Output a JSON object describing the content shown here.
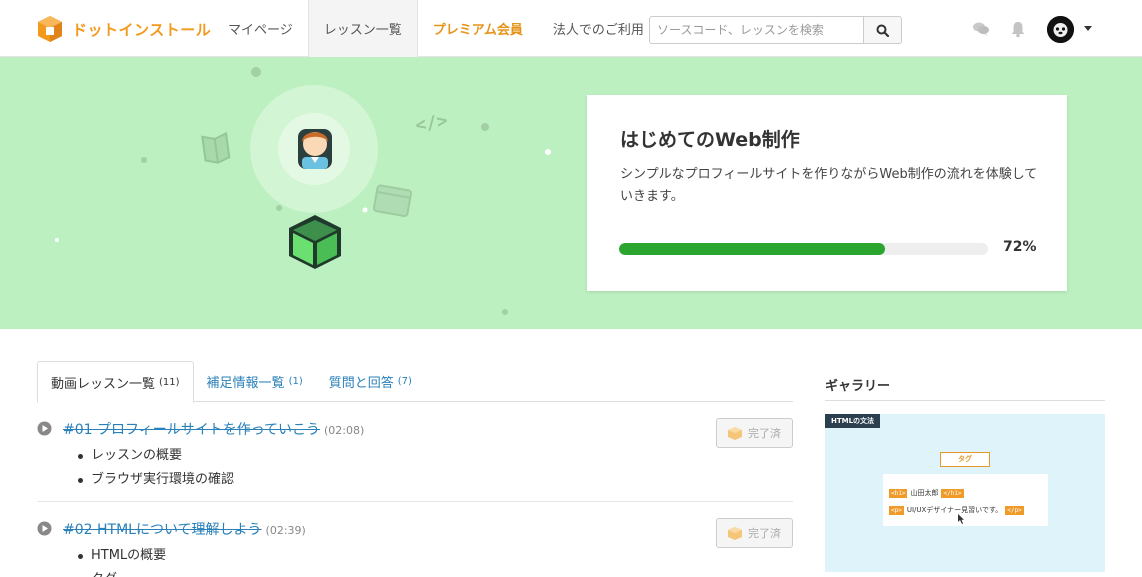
{
  "header": {
    "logo_text": "ドットインストール",
    "nav": [
      {
        "label": "マイページ"
      },
      {
        "label": "レッスン一覧"
      },
      {
        "label": "プレミアム会員"
      },
      {
        "label": "法人でのご利用"
      }
    ],
    "search_placeholder": "ソースコード、レッスンを検索"
  },
  "hero": {
    "title": "はじめてのWeb制作",
    "description": "シンプルなプロフィールサイトを作りながらWeb制作の流れを体験していきます。",
    "progress_percent": 72,
    "progress_label": "72%"
  },
  "tabs": [
    {
      "label": "動画レッスン一覧",
      "count": "(11)"
    },
    {
      "label": "補足情報一覧",
      "count": "(1)"
    },
    {
      "label": "質問と回答",
      "count": "(7)"
    }
  ],
  "lessons": [
    {
      "title": "#01 プロフィールサイトを作っていこう",
      "duration": "(02:08)",
      "topics": [
        "レッスンの概要",
        "ブラウザ実行環境の確認"
      ],
      "status": "完了済"
    },
    {
      "title": "#02 HTMLについて理解しよう",
      "duration": "(02:39)",
      "topics": [
        "HTMLの概要",
        "タグ"
      ],
      "status": "完了済"
    }
  ],
  "gallery": {
    "title": "ギャラリー",
    "thumb_label": "HTMLの文法",
    "thumb_tag": "タグ",
    "line1": {
      "open": "<h1>",
      "text": "山田太郎",
      "close": "</h1>"
    },
    "line2": {
      "open": "<p>",
      "text": "UI/UXデザイナー見習いです。",
      "close": "</p>"
    }
  },
  "colors": {
    "brand": "#f39a1e",
    "hero_bg": "#bdf0c0",
    "progress": "#2aa52f",
    "link": "#2a80b9"
  }
}
